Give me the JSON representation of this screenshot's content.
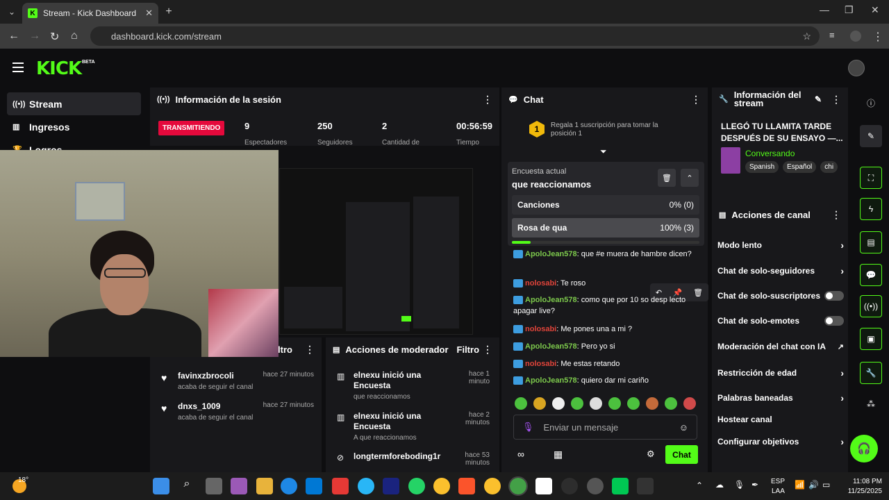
{
  "browser": {
    "tab_title": "Stream - Kick Dashboard",
    "url": "dashboard.kick.com/stream"
  },
  "header": {
    "logo": "KICK",
    "beta": "BETA"
  },
  "sidebar": {
    "items": [
      {
        "label": "Stream",
        "icon": "broadcast-icon"
      },
      {
        "label": "Ingresos",
        "icon": "chart-icon"
      },
      {
        "label": "Logros",
        "icon": "trophy-icon"
      }
    ]
  },
  "session": {
    "title": "Información de la sesión",
    "live_badge": "TRANSMITIENDO",
    "stats": [
      {
        "value": "9",
        "label": "Espectadores"
      },
      {
        "value": "250",
        "label": "Seguidores"
      },
      {
        "value": "2",
        "label": "Cantidad de"
      },
      {
        "value": "00:56:59",
        "label": "Tiempo"
      }
    ]
  },
  "chat": {
    "title": "Chat",
    "gift_notice": "Regala 1 suscripción para tomar la posición 1",
    "gift_rank": "1",
    "poll": {
      "label": "Encuesta actual",
      "question": "que reaccionamos",
      "options": [
        {
          "name": "Canciones",
          "pct": "0% (0)",
          "fraction": 0
        },
        {
          "name": "Rosa de qua",
          "pct": "100% (3)",
          "fraction": 1
        }
      ]
    },
    "messages": [
      {
        "user": "ApoloJean578",
        "text": "que #e muera de hambre dicen?",
        "color": "green"
      },
      {
        "user": "nolosabi",
        "text": "Te roso",
        "color": "red"
      },
      {
        "user": "ApoloJean578",
        "text": "como que por 10 so desp lecto apagar live?",
        "color": "green"
      },
      {
        "user": "nolosabi",
        "text": "Me pones una a mi ?",
        "color": "red"
      },
      {
        "user": "ApoloJean578",
        "text": "Pero yo si",
        "color": "green"
      },
      {
        "user": "nolosabi",
        "text": "Me estas retando",
        "color": "red"
      },
      {
        "user": "ApoloJean578",
        "text": "quiero dar mi cariño",
        "color": "green"
      }
    ],
    "input_placeholder": "Enviar un mensaje",
    "send_label": "Chat"
  },
  "stream_info": {
    "title": "Información del stream",
    "stream_title": "LLEGÓ TU LLAMITA TARDE DESPUÉS DE SU ENSAYO —...",
    "category": "Conversando",
    "tags": [
      "Spanish",
      "Español",
      "chi"
    ]
  },
  "channel_actions": {
    "title": "Acciones de canal",
    "items": [
      {
        "label": "Modo lento",
        "control": "chevron"
      },
      {
        "label": "Chat de solo-seguidores",
        "control": "chevron"
      },
      {
        "label": "Chat de solo-suscriptores",
        "control": "toggle"
      },
      {
        "label": "Chat de solo-emotes",
        "control": "toggle"
      },
      {
        "label": "Moderación del chat con IA",
        "control": "external"
      },
      {
        "label": "Restricción de edad",
        "control": "chevron"
      },
      {
        "label": "Palabras baneadas",
        "control": "chevron"
      },
      {
        "label": "Hostear canal",
        "control": "none"
      },
      {
        "label": "Configurar objetivos",
        "control": "chevron"
      }
    ]
  },
  "activity_feed": {
    "filter_suffix": "ltro",
    "rows": [
      {
        "name": "favinxzbrocoli",
        "time": "hace 27 minutos",
        "sub": "acaba de seguir el canal"
      },
      {
        "name": "dnxs_1009",
        "time": "hace 27 minutos",
        "sub": "acaba de seguir el canal"
      }
    ]
  },
  "mod_actions": {
    "title": "Acciones de moderador",
    "filter": "Filtro",
    "rows": [
      {
        "name": "elnexu inició una Encuesta",
        "time": "hace 1 minuto",
        "sub": "que reaccionamos"
      },
      {
        "name": "elnexu inició una Encuesta",
        "time": "hace 2 minutos",
        "sub": "A que reaccionamos"
      },
      {
        "name": "longtermforeboding1r",
        "time": "hace 53 minutos",
        "sub": ""
      }
    ]
  },
  "taskbar": {
    "weather": "18°",
    "lang": "ESP",
    "lang2": "LAA",
    "time": "11:08 PM",
    "date": "11/25/2025"
  },
  "colors": {
    "brand": "#53fc18",
    "live": "#e5093c",
    "panel": "#18181b"
  }
}
